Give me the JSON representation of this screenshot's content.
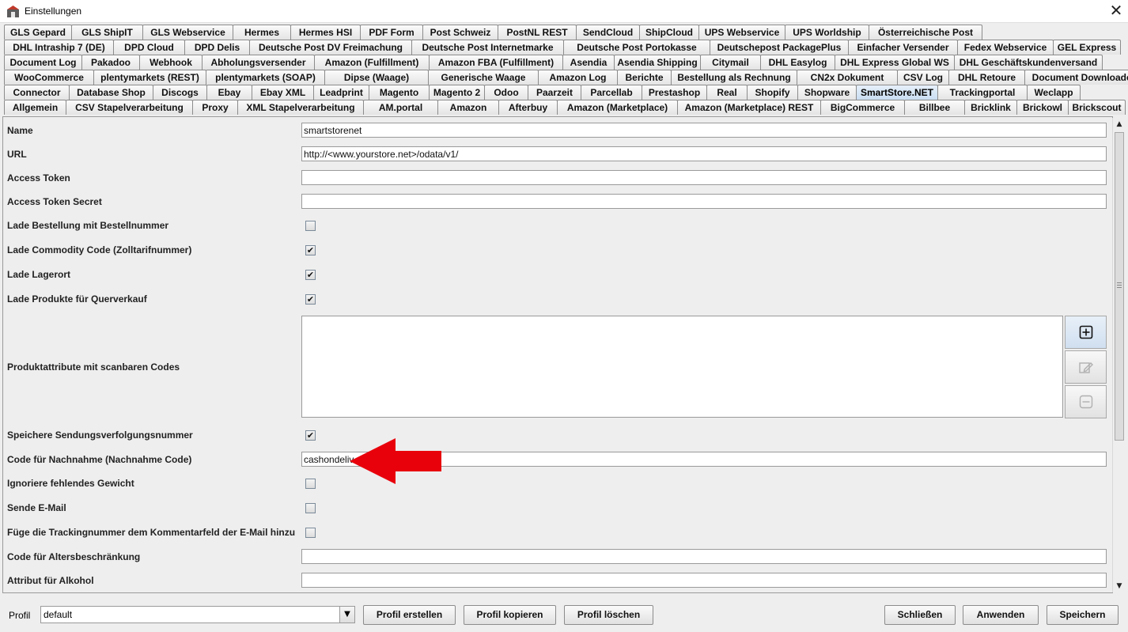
{
  "window": {
    "title": "Einstellungen",
    "close_glyph": "✕"
  },
  "tab_rows": [
    [
      "GLS Gepard",
      "GLS ShipIT",
      "GLS Webservice",
      "Hermes",
      "Hermes HSI",
      "PDF Form",
      "Post Schweiz",
      "PostNL REST",
      "SendCloud",
      "ShipCloud",
      "UPS Webservice",
      "UPS Worldship",
      "Österreichische Post"
    ],
    [
      "DHL Intraship 7 (DE)",
      "DPD Cloud",
      "DPD Delis",
      "Deutsche Post DV Freimachung",
      "Deutsche Post Internetmarke",
      "Deutsche Post Portokasse",
      "Deutschepost PackagePlus",
      "Einfacher Versender",
      "Fedex Webservice",
      "GEL Express"
    ],
    [
      "Document Log",
      "Pakadoo",
      "Webhook",
      "Abholungsversender",
      "Amazon (Fulfillment)",
      "Amazon FBA (Fulfillment)",
      "Asendia",
      "Asendia Shipping",
      "Citymail",
      "DHL Easylog",
      "DHL Express Global WS",
      "DHL Geschäftskundenversand"
    ],
    [
      "WooCommerce",
      "plentymarkets (REST)",
      "plentymarkets (SOAP)",
      "Dipse (Waage)",
      "Generische Waage",
      "Amazon Log",
      "Berichte",
      "Bestellung als Rechnung",
      "CN2x Dokument",
      "CSV Log",
      "DHL Retoure",
      "Document Downloader"
    ],
    [
      "Connector",
      "Database Shop",
      "Discogs",
      "Ebay",
      "Ebay XML",
      "Leadprint",
      "Magento",
      "Magento 2",
      "Odoo",
      "Paarzeit",
      "Parcellab",
      "Prestashop",
      "Real",
      "Shopify",
      "Shopware",
      "SmartStore.NET",
      "Trackingportal",
      "Weclapp"
    ],
    [
      "Allgemein",
      "CSV Stapelverarbeitung",
      "Proxy",
      "XML Stapelverarbeitung",
      "AM.portal",
      "Amazon",
      "Afterbuy",
      "Amazon (Marketplace)",
      "Amazon (Marketplace) REST",
      "BigCommerce",
      "Billbee",
      "Bricklink",
      "Brickowl",
      "Brickscout"
    ]
  ],
  "active_tab": "SmartStore.NET",
  "form": {
    "name_label": "Name",
    "name_value": "smartstorenet",
    "url_label": "URL",
    "url_value": "http://<www.yourstore.net>/odata/v1/",
    "access_token_label": "Access Token",
    "access_token_value": "",
    "access_token_secret_label": "Access Token Secret",
    "access_token_secret_value": "",
    "lade_bestellung_label": "Lade Bestellung mit Bestellnummer",
    "lade_bestellung_checked": false,
    "lade_commodity_label": "Lade Commodity Code (Zolltarifnummer)",
    "lade_commodity_checked": true,
    "lade_lagerort_label": "Lade Lagerort",
    "lade_lagerort_checked": true,
    "lade_produkte_label": "Lade Produkte für Querverkauf",
    "lade_produkte_checked": true,
    "produktattribute_label": "Produktattribute mit scanbaren Codes",
    "speichere_label": "Speichere Sendungsverfolgungsnummer",
    "speichere_checked": true,
    "nachnahme_label": "Code für Nachnahme (Nachnahme Code)",
    "nachnahme_value": "cashondeliv",
    "ignoriere_label": "Ignoriere fehlendes Gewicht",
    "ignoriere_checked": false,
    "sende_label": "Sende E-Mail",
    "sende_checked": false,
    "fuege_label": "Füge die Trackingnummer dem Kommentarfeld der E-Mail hinzu",
    "fuege_checked": false,
    "alters_label": "Code für Altersbeschränkung",
    "alters_value": "",
    "alkohol_label": "Attribut für Alkohol",
    "alkohol_value": ""
  },
  "check_glyph": "✔",
  "side_buttons": [
    "plus-icon",
    "edit-icon",
    "minus-icon"
  ],
  "footer": {
    "profil_label": "Profil",
    "profil_value": "default",
    "combo_arrow": "▼",
    "profil_erstellen": "Profil erstellen",
    "profil_kopieren": "Profil kopieren",
    "profil_loeschen": "Profil löschen",
    "schliessen": "Schließen",
    "anwenden": "Anwenden",
    "speichern": "Speichern"
  },
  "scroll_up_glyph": "▲",
  "scroll_down_glyph": "▼",
  "colors": {
    "active_tab": "#c9ddf2",
    "annotation_arrow": "#e8000b"
  }
}
